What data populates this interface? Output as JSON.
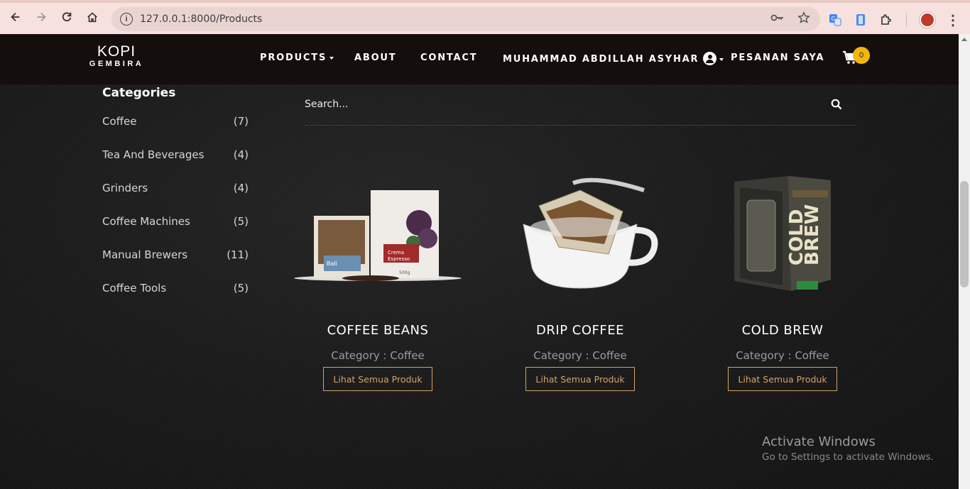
{
  "browser": {
    "url": "127.0.0.1:8000/Products"
  },
  "header": {
    "logo_top": "KOPI",
    "logo_bottom": "GEMBIRA",
    "menu": {
      "products": "PRODUCTS",
      "about": "ABOUT",
      "contact": "CONTACT",
      "user": "MUHAMMAD ABDILLAH ASYHAR",
      "orders": "PESANAN SAYA"
    },
    "cart_count": "0"
  },
  "sidebar": {
    "title": "Categories",
    "items": [
      {
        "label": "Coffee",
        "count": "(7)"
      },
      {
        "label": "Tea And Beverages",
        "count": "(4)"
      },
      {
        "label": "Grinders",
        "count": "(4)"
      },
      {
        "label": "Coffee Machines",
        "count": "(5)"
      },
      {
        "label": "Manual Brewers",
        "count": "(11)"
      },
      {
        "label": "Coffee Tools",
        "count": "(5)"
      }
    ]
  },
  "search": {
    "placeholder": "Search..."
  },
  "products": [
    {
      "name": "COFFEE BEANS",
      "category": "Category : Coffee",
      "button": "Lihat Semua Produk"
    },
    {
      "name": "DRIP COFFEE",
      "category": "Category : Coffee",
      "button": "Lihat Semua Produk"
    },
    {
      "name": "COLD BREW",
      "category": "Category : Coffee",
      "button": "Lihat Semua Produk"
    }
  ],
  "watermark": {
    "line1": "Activate Windows",
    "line2": "Go to Settings to activate Windows."
  },
  "colors": {
    "accent": "#d4a26a",
    "badge": "#f5b60b",
    "header_bg": "#140f0d"
  }
}
